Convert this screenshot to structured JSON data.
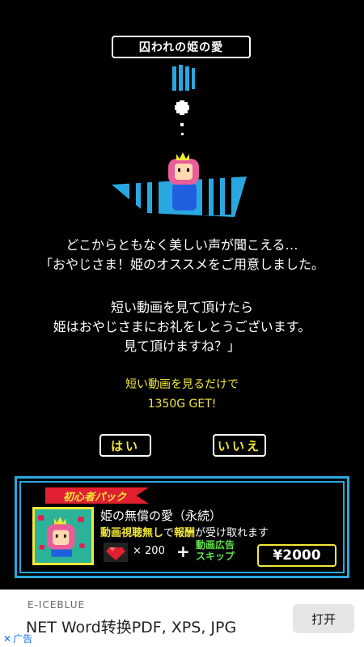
{
  "title": "囚われの姫の愛",
  "dialog": {
    "lines": [
      "どこからともなく美しい声が聞こえる…",
      "「おやじさま！姫のオススメをご用意しました。",
      "",
      "短い動画を見て頂けたら",
      "姫はおやじさまにお礼をしとうございます。",
      "見て頂けますね？」"
    ]
  },
  "reward": {
    "line1": "短い動画を見るだけで",
    "line2": "1350G GET!"
  },
  "choices": {
    "yes": "はい",
    "no": "いいえ"
  },
  "pack": {
    "ribbon": "初心者パック",
    "name": "姫の無償の愛（永続）",
    "desc_hl1": "動画視聴無し",
    "desc_mid": "で",
    "desc_hl2": "報酬",
    "desc_end": "が受け取れます",
    "gem_count": "× 200",
    "plus": "+",
    "skip_line1": "動画広告",
    "skip_line2": "スキップ",
    "price": "¥2000",
    "icon": "princess-portrait-icon",
    "gem_icon": "red-gem-icon"
  },
  "ad": {
    "brand": "E-ICEBLUE",
    "text": "NET Word转换PDF, XPS, JPG",
    "cta": "打开",
    "mark": "广告",
    "close_symbol": "✕"
  },
  "colors": {
    "accent_yellow": "#f2e73a",
    "accent_blue": "#29a8e0",
    "ribbon_red": "#e02030",
    "skip_green": "#5fe04a"
  }
}
